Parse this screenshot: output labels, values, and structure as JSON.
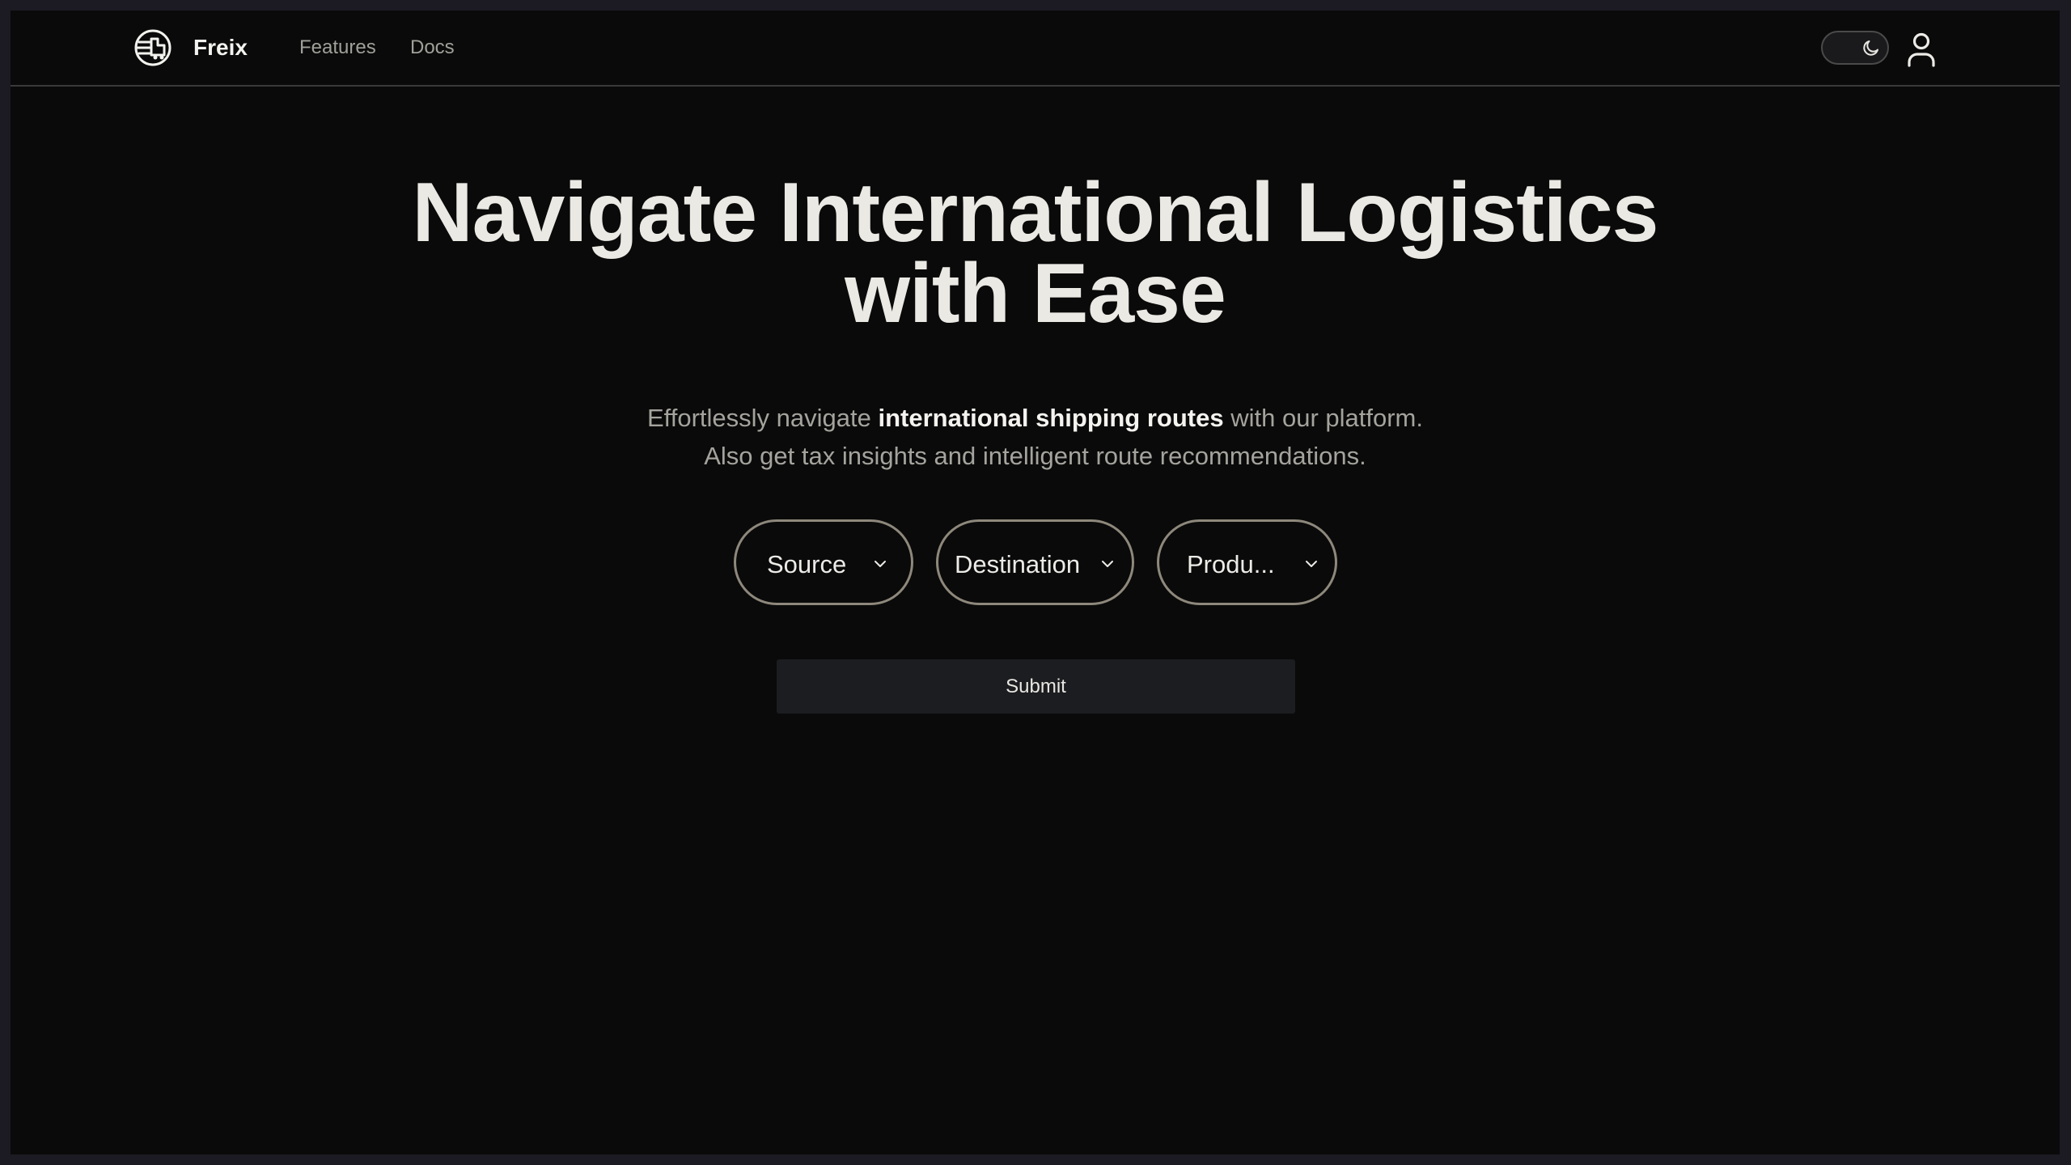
{
  "navbar": {
    "brand": "Freix",
    "links": [
      "Features",
      "Docs"
    ],
    "logo_icon": "globe-ship-icon",
    "theme_icon": "moon-icon",
    "user_icon": "user-icon"
  },
  "hero": {
    "title_line1": "Navigate International Logistics",
    "title_line2": "with Ease",
    "subtitle_pre": "Effortlessly navigate ",
    "subtitle_bold": "international shipping routes",
    "subtitle_post": " with our platform.",
    "subtitle_line2": "Also get tax insights and intelligent route recommendations."
  },
  "form": {
    "source_label": "Source",
    "destination_label": "Destination",
    "product_label": "Produ...",
    "submit_label": "Submit"
  },
  "colors": {
    "background": "#0a0a0a",
    "frame": "#1c1b24",
    "text_primary": "#ebe9e4",
    "text_muted": "#a4a39d",
    "select_border": "#8e887c",
    "button_bg": "#1c1d20"
  }
}
